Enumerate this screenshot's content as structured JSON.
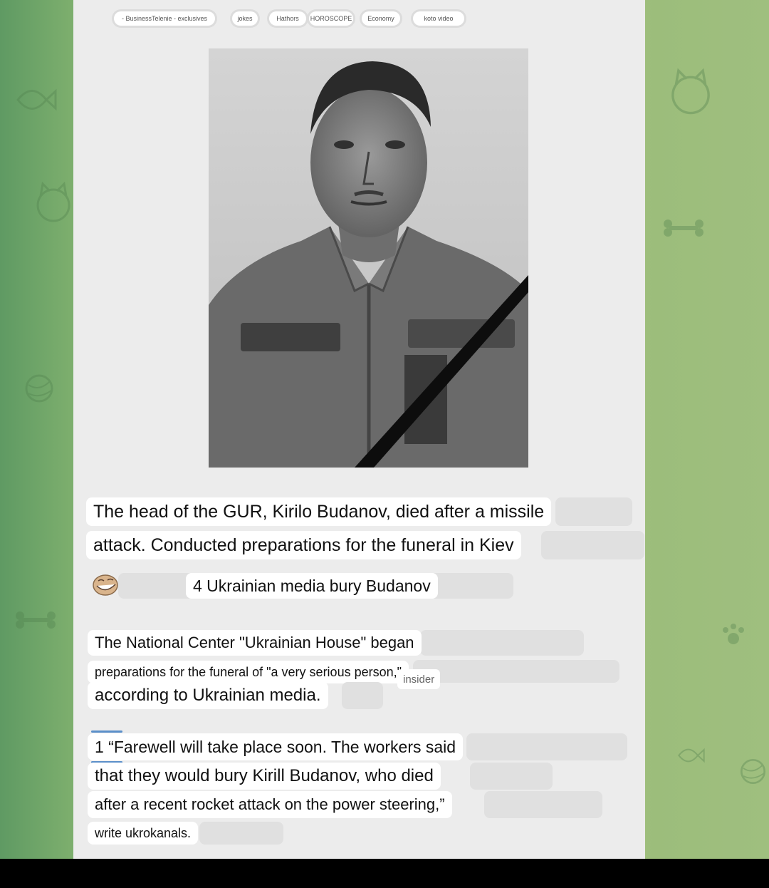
{
  "tabs": [
    {
      "label": "- BusinessTelenie - exclusives"
    },
    {
      "label": "jokes"
    },
    {
      "label": "Hathors"
    },
    {
      "label": "HOROSCOPE"
    },
    {
      "label": "Economy"
    },
    {
      "label": "koto video"
    }
  ],
  "post": {
    "headline_line1": "The head of the GUR, Kirilo Budanov, died after a missile",
    "headline_line2": "attack. Conducted preparations for the funeral in Kiev",
    "media_caption": "4 Ukrainian media bury Budanov",
    "para1_line1": "The National Center \"Ukrainian House\" began",
    "para1_line2": "preparations for the funeral of \"a very serious person,\"",
    "para1_tag": "insider",
    "para1_line3": "according to Ukrainian media.",
    "quote_line1": "1 “Farewell will take place soon. The workers said",
    "quote_line2": "that they would bury Kirill Budanov, who died",
    "quote_line3": "after a recent rocket attack on the power steering,”",
    "quote_line4": "write ukrokanals."
  },
  "colors": {
    "accent": "#5b8fc9",
    "panel": "#ececec",
    "bubble": "#ffffff"
  }
}
